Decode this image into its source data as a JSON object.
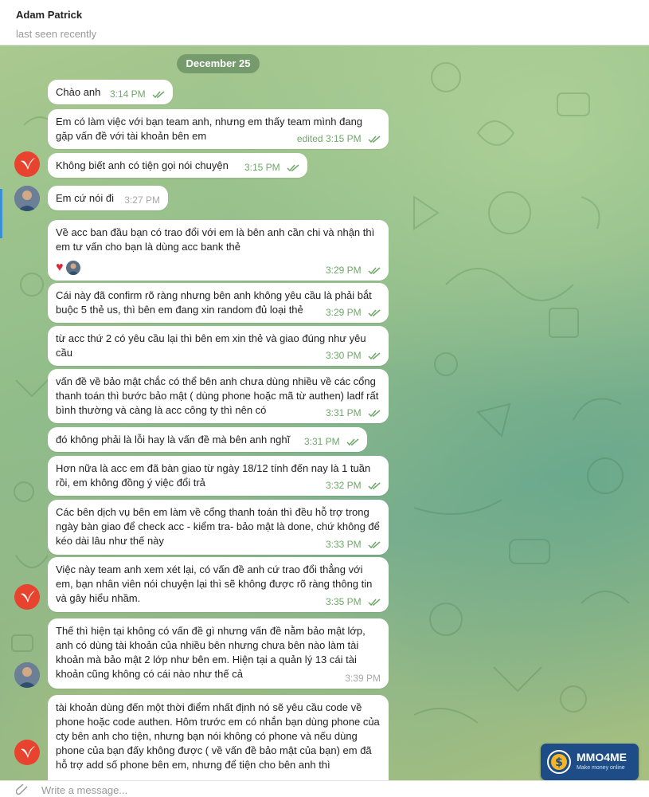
{
  "header": {
    "contact_name": "Adam Patrick",
    "status": "last seen recently"
  },
  "chat": {
    "date_separator": "December 25",
    "messages": [
      {
        "text": "Chào anh",
        "time": "3:14 PM",
        "read": true
      },
      {
        "text": "Em có làm việc với bạn team anh, nhưng em thấy team mình đang gặp vấn đề với tài khoản bên em",
        "edited_label": "edited",
        "time": "3:15 PM",
        "read": true
      },
      {
        "text": "Không biết anh có tiện gọi nói chuyện",
        "time": "3:15 PM",
        "read": true
      },
      {
        "text": "Em cứ nói đi",
        "time": "3:27 PM",
        "incoming": true
      },
      {
        "text": "Về acc ban đầu bạn có trao đổi với em là bên anh cần chi và nhận thì em tư vấn cho bạn là dùng acc bank thẻ",
        "time": "3:29 PM",
        "read": true,
        "reactions": [
          "heart",
          "avatar"
        ]
      },
      {
        "text": "Cái này đã confirm rõ ràng nhưng bên anh không yêu cầu là phải bắt buộc 5 thẻ us, thì bên em đang xin random đủ loại thẻ",
        "time": "3:29 PM",
        "read": true
      },
      {
        "text": "từ acc thứ 2 có yêu cầu lại thì bên em xin thẻ và giao đúng như yêu cầu",
        "time": "3:30 PM",
        "read": true
      },
      {
        "text": "vấn đề về bảo mật chắc có thể bên anh chưa dùng nhiều về các cổng thanh toán thì bước bảo mật ( dùng phone hoặc mã từ authen) ladf rất bình thường và càng là acc công ty thì nên có",
        "time": "3:31 PM",
        "read": true
      },
      {
        "text": "đó không phải là lỗi hay là vấn đề mà bên anh nghĩ",
        "time": "3:31 PM",
        "read": true
      },
      {
        "text": "Hơn nữa là acc em đã bàn giao từ ngày 18/12 tính đến nay là 1 tuần rồi, em không đồng ý việc đổi trả",
        "time": "3:32 PM",
        "read": true
      },
      {
        "text": "Các bên dịch vụ bên em làm về cổng thanh toán thì đều hỗ trợ trong ngày bàn giao để check acc - kiểm tra- bảo mật là done, chứ không để kéo dài lâu như thế này",
        "time": "3:33 PM",
        "read": true
      },
      {
        "text": "Việc này team anh xem xét lại, có vấn đề anh cứ trao đổi thẳng với em, bạn nhân viên nói chuyện lại thì sẽ không được rõ ràng thông tin và gây hiểu nhầm.",
        "time": "3:35 PM",
        "read": true
      },
      {
        "text": "Thế thì hiện tại không có vấn đề gì nhưng vấn đề nằm bảo mật lớp, anh có dùng tài khoản của nhiều bên nhưng chưa bên nào làm tài khoản mà bảo mật 2 lớp như bên em. Hiện tại a quản lý 13 cái tài khoản cũng không có cái nào như thế cả",
        "time": "3:39 PM",
        "incoming": true
      },
      {
        "text": "tài khoản dùng đến một thời điểm nhất định nó sẽ yêu cầu code về phone hoặc code authen. Hôm trước em có nhắn bạn dùng phone của cty bên anh cho tiện, nhưng bạn nói không có phone và nếu dùng phone của bạn đấy không được ( về vấn đề bảo mật của bạn) em đã hỗ trợ add số phone bên em, nhưng để tiện cho bên anh thì",
        "time": "",
        "read": true
      }
    ]
  },
  "composer": {
    "placeholder": "Write a message..."
  },
  "watermark": {
    "brand": "MMO4ME",
    "tagline": "Make money online"
  },
  "colors": {
    "outgoing_time": "#6fa86a",
    "avatar_brand": "#e8432e",
    "date_pill": "#5f8a5a",
    "selection_marker": "#3a8fd6",
    "watermark_bg": "#1d4c86"
  }
}
